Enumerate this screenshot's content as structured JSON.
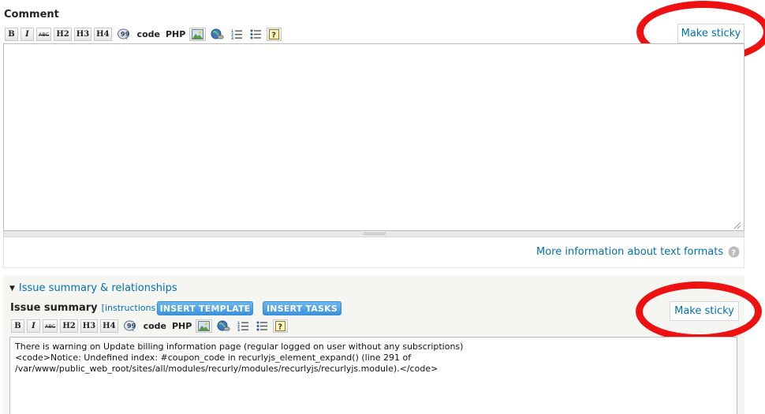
{
  "comment": {
    "label": "Comment",
    "make_sticky": "Make sticky",
    "body": "",
    "more_info": "More information about text formats",
    "help_icon": "help-icon"
  },
  "toolbar": {
    "bold": "B",
    "italic": "I",
    "strike": "ABC",
    "h2": "H2",
    "h3": "H3",
    "h4": "H4",
    "code": "code",
    "php": "PHP"
  },
  "issue": {
    "section_title": "Issue summary & relationships",
    "label": "Issue summary",
    "instructions": "[instructions]",
    "insert_template": "INSERT TEMPLATE",
    "insert_tasks": "INSERT TASKS",
    "make_sticky": "Make sticky",
    "body_line1": "There is warning on Update billing information page (regular logged on user without any subscriptions)",
    "body_line2": "<code>Notice: Undefined index: #coupon_code in recurlyjs_element_expand() (line 291 of",
    "body_line3": "/var/www/public_web_root/sites/all/modules/recurly/modules/recurlyjs/recurlyjs.module).</code>"
  },
  "colors": {
    "link": "#0071b3",
    "highlight_ring": "#ee1111",
    "panel_bg": "#f5f5f2"
  }
}
